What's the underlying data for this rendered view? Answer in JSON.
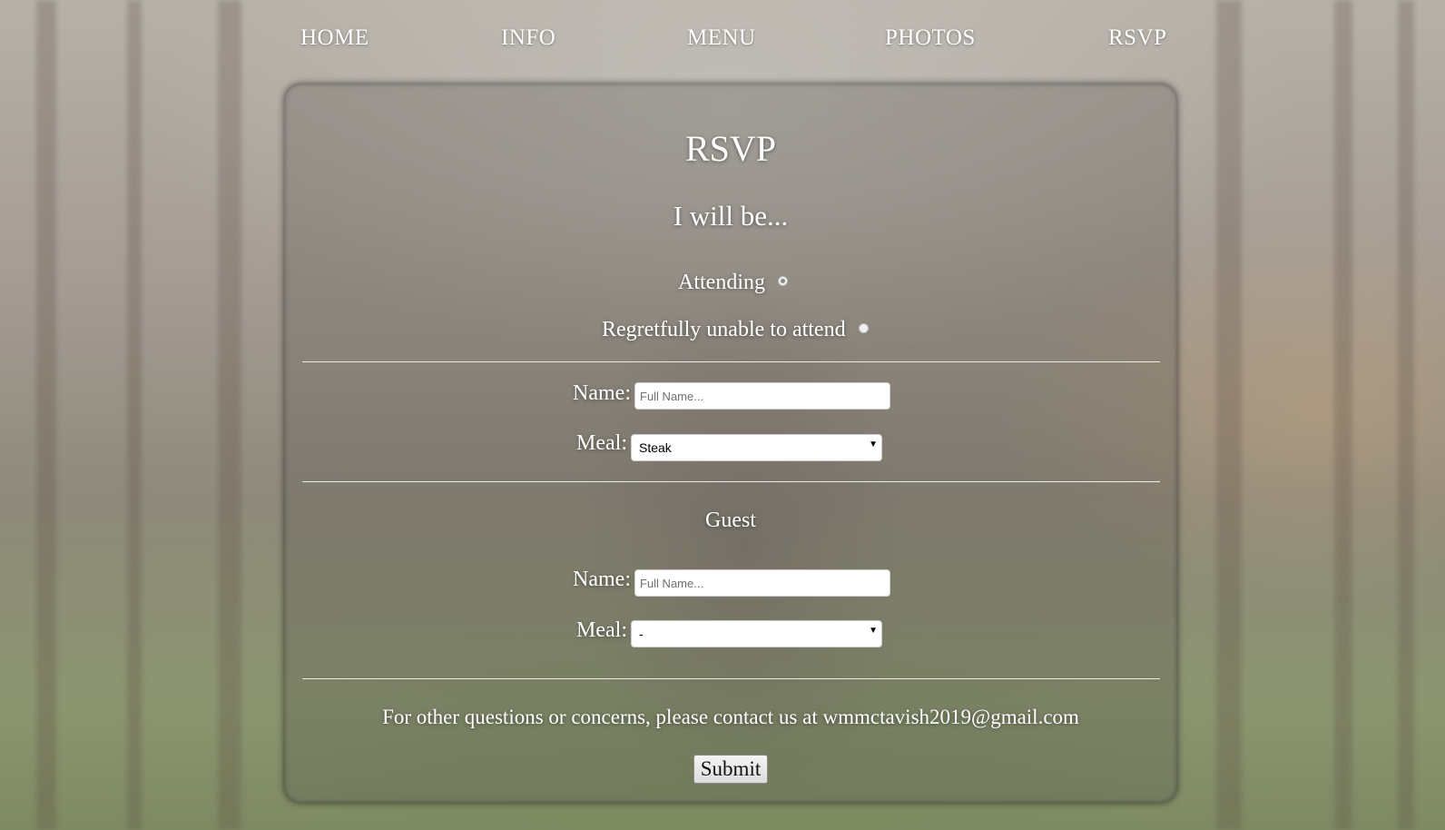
{
  "nav": {
    "items": [
      "HOME",
      "INFO",
      "MENU",
      "PHOTOS",
      "RSVP"
    ]
  },
  "form": {
    "title": "RSVP",
    "subtitle": "I will be...",
    "attendance": {
      "attending_label": "Attending",
      "declining_label": "Regretfully unable to attend"
    },
    "primary": {
      "name_label": "Name:",
      "name_placeholder": "Full Name...",
      "meal_label": "Meal:",
      "meal_selected": "Steak"
    },
    "guest": {
      "heading": "Guest",
      "name_label": "Name:",
      "name_placeholder": "Full Name...",
      "meal_label": "Meal:",
      "meal_selected": "-"
    },
    "contact_text": "For other questions or concerns, please contact us at wmmctavish2019@gmail.com",
    "submit_label": "Submit"
  },
  "icons": {
    "select_arrow": "caret-down-icon"
  }
}
